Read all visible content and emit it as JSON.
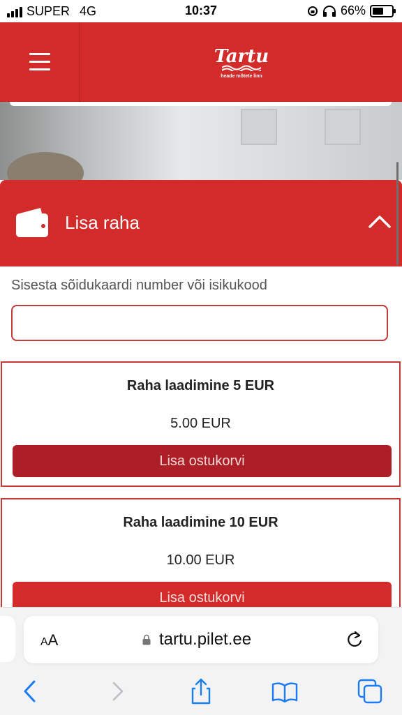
{
  "status_bar": {
    "carrier": "SUPER",
    "network": "4G",
    "time": "10:37",
    "battery": "66%",
    "battery_level": 0.66
  },
  "header": {
    "logo_text": "Tartu",
    "logo_tagline": "heade mõtete linn",
    "brand_color": "#d32a2a"
  },
  "panel": {
    "title": "Lisa raha",
    "icon": "wallet-icon",
    "expanded": true
  },
  "form": {
    "label": "Sisesta sõidukaardi number või isikukood",
    "value": "",
    "placeholder": ""
  },
  "products": [
    {
      "name": "Raha laadimine 5 EUR",
      "price": "5.00 EUR",
      "button": "Lisa ostukorvi"
    },
    {
      "name": "Raha laadimine 10 EUR",
      "price": "10.00 EUR",
      "button": "Lisa ostukorvi"
    }
  ],
  "browser": {
    "text_size": "AA",
    "url": "tartu.pilet.ee",
    "toolbar": [
      "back-icon",
      "forward-icon",
      "share-icon",
      "bookmarks-icon",
      "tabs-icon"
    ]
  }
}
